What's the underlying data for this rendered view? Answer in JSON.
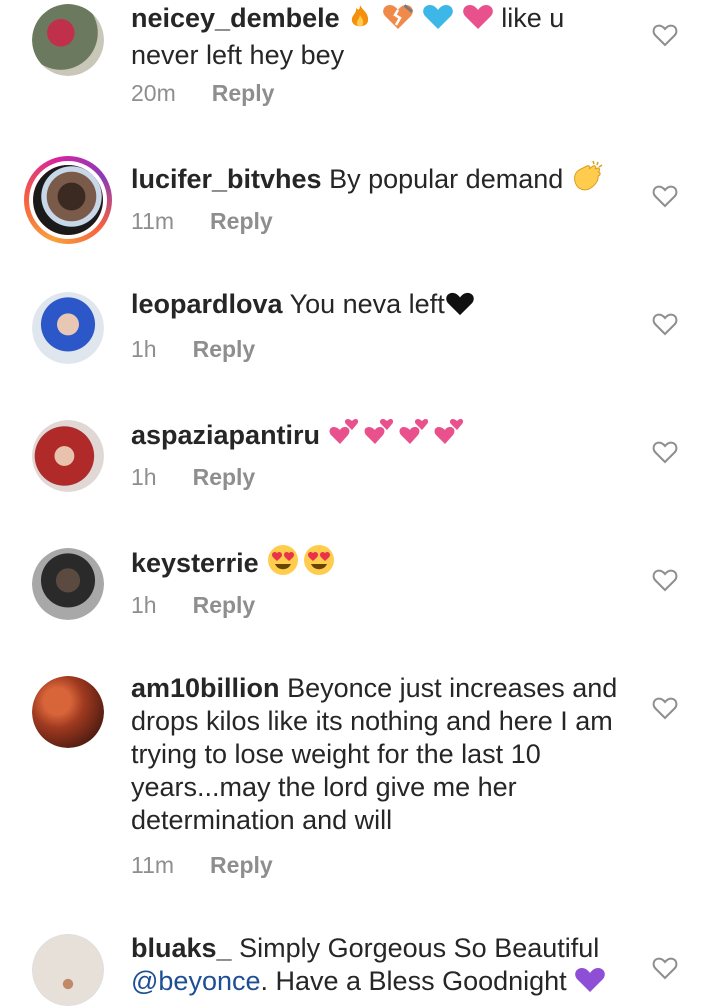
{
  "reply_label": "Reply",
  "comments": [
    {
      "username": "neicey_dembele",
      "text": "like u never left hey bey",
      "time": "20m"
    },
    {
      "username": "lucifer_bitvhes",
      "text": "By popular demand",
      "time": "11m"
    },
    {
      "username": "leopardlova",
      "text": "You neva left",
      "time": "1h"
    },
    {
      "username": "aspaziapantiru",
      "text": "",
      "time": "1h"
    },
    {
      "username": "keysterrie",
      "text": "",
      "time": "1h"
    },
    {
      "username": "am10billion",
      "text": "Beyonce just increases and drops kilos like its nothing and here I am trying to lose weight for the last 10 years...may the lord give me her determination and will",
      "time": "11m"
    },
    {
      "username": "bluaks_",
      "text": "Simply Gorgeous So Beautiful",
      "mention": "@beyonce",
      "text_after": ". Have a Bless Goodnight",
      "time": ""
    }
  ],
  "icons": {
    "like": "heart-outline-icon",
    "emojis": [
      "fire",
      "broken-heart",
      "blue-heart",
      "pink-heart",
      "clapping-hands",
      "black-heart",
      "two-hearts",
      "heart-eyes",
      "purple-heart"
    ]
  }
}
